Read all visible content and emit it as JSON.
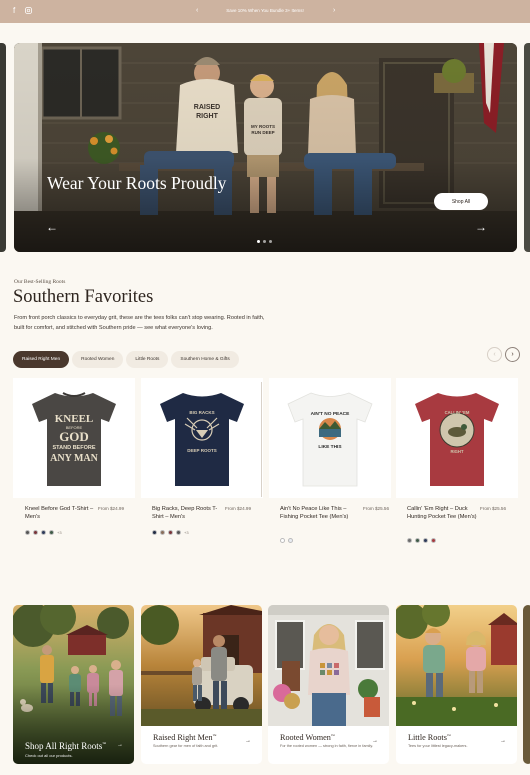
{
  "announcement": {
    "text": "Save 10% When You Bundle 3+ Items!",
    "social_icons": [
      "facebook-icon",
      "instagram-icon"
    ],
    "prev_icon": "‹",
    "next_icon": "›"
  },
  "hero": {
    "title": "Wear Your Roots Proudly",
    "button_label": "Shop All",
    "prev_icon": "←",
    "next_icon": "→",
    "slide_count": 3,
    "active_slide": 1,
    "shirt_text_dad": "RAISED RIGHT",
    "shirt_text_kid": "MY ROOTS RUN DEEP"
  },
  "section": {
    "eyebrow": "Our Best-Selling Roots",
    "title": "Southern Favorites",
    "description": "From front porch classics to everyday grit, these are the tees folks can't stop wearing. Rooted in faith, built for comfort, and stitched with Southern pride — see what everyone's loving.",
    "tabs": [
      "Raised Right Men",
      "Rooted Women",
      "Little Roots",
      "Southern Home & Gifts"
    ],
    "active_tab": 0,
    "prev_icon": "‹",
    "next_icon": "›"
  },
  "products": [
    {
      "name": "Kneel Before God T-Shirt – Men's",
      "price": "From $24.99",
      "shirt_color": "#4a4744",
      "print_lines": [
        "KNEEL",
        "BEFORE",
        "GOD",
        "STAND BEFORE",
        "ANY MAN"
      ],
      "swatches": [
        "#555555",
        "#7a3338",
        "#2d3a5a",
        "#3f5b47"
      ],
      "more": "+3"
    },
    {
      "name": "Big Racks, Deep Roots T-Shirt – Men's",
      "price": "From $24.99",
      "shirt_color": "#1f2a44",
      "print_lines": [
        "BIG RACKS",
        "DEEP ROOTS"
      ],
      "swatches": [
        "#1f2a44",
        "#8a6e5a",
        "#7a3338",
        "#555555"
      ],
      "more": "+3"
    },
    {
      "name": "Ain't No Peace Like This – Fishing Pocket Tee (Men's)",
      "price": "From $25.56",
      "shirt_color": "#f4f4f2",
      "print_lines": [
        "AIN'T NO PEACE",
        "LIKE THIS"
      ],
      "swatches": [
        "#ffffff",
        "#e8ecf2"
      ],
      "more": ""
    },
    {
      "name": "Callin' 'Em Right – Duck Hunting Pocket Tee (Men's)",
      "price": "From $25.56",
      "shirt_color": "#a83a40",
      "print_lines": [
        "CALLIN' 'EM",
        "RIGHT"
      ],
      "swatches": [
        "#6b6b6b",
        "#3f5b47",
        "#2d3a5a",
        "#a83a40"
      ],
      "more": ""
    }
  ],
  "collections": [
    {
      "title": "Shop All Right Roots",
      "badge": "™",
      "subtitle": "Check out all our products.",
      "arrow": "→"
    },
    {
      "title": "Raised Right Men",
      "badge": "™",
      "subtitle": "Southern gear for men of faith and grit.",
      "arrow": "→"
    },
    {
      "title": "Rooted Women",
      "badge": "™",
      "subtitle": "For the rooted women — strong in faith, fierce in family.",
      "arrow": "→"
    },
    {
      "title": "Little Roots",
      "badge": "™",
      "subtitle": "Tees for your littlest legacy-makers.",
      "arrow": "→"
    }
  ]
}
